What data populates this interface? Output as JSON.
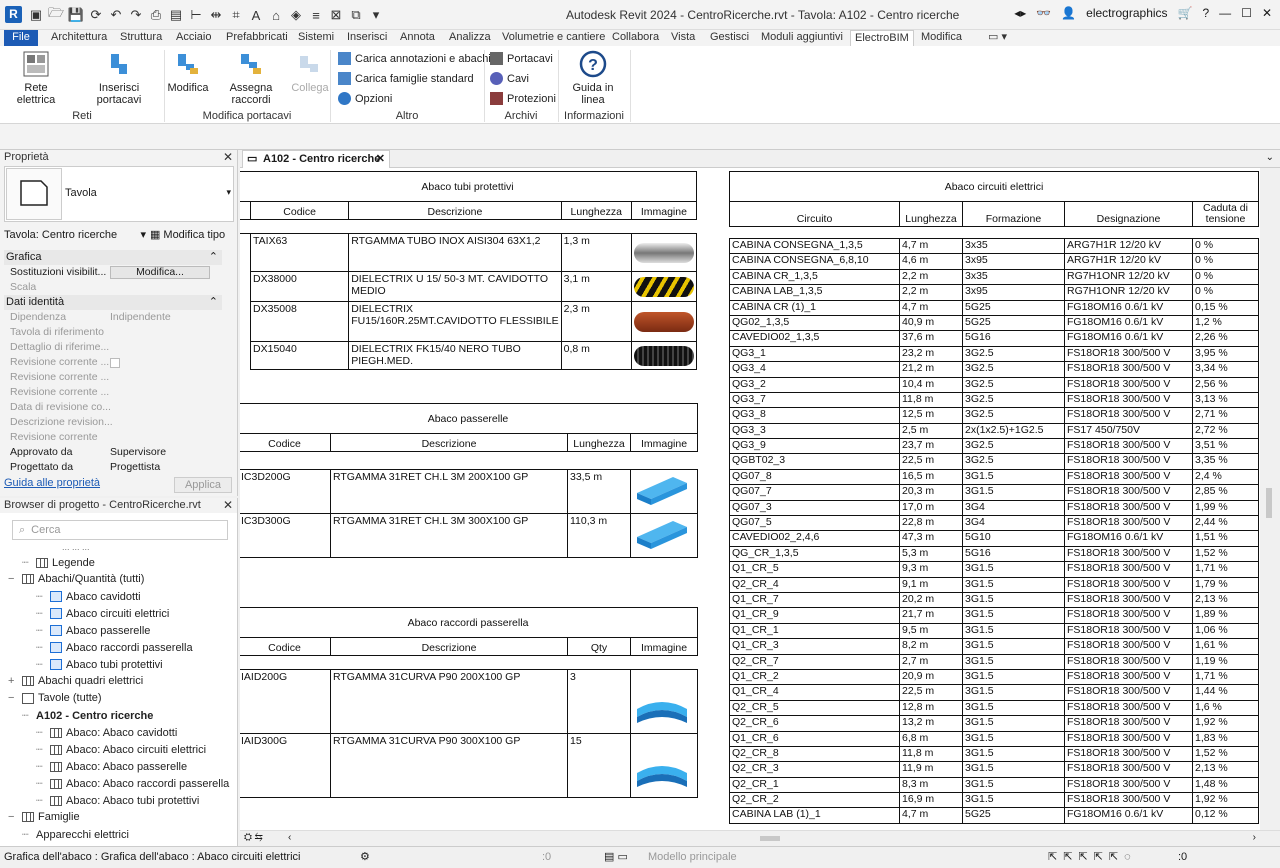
{
  "window": {
    "title": "Autodesk Revit 2024 - CentroRicerche.rvt - Tavola: A102 - Centro ricerche",
    "user": "electrographics"
  },
  "menu_tabs": [
    "File",
    "Architettura",
    "Struttura",
    "Acciaio",
    "Prefabbricati",
    "Sistemi",
    "Inserisci",
    "Annota",
    "Analizza",
    "Volumetrie e cantiere",
    "Collabora",
    "Vista",
    "Gestisci",
    "Moduli aggiuntivi",
    "ElectroBIM",
    "Modifica"
  ],
  "ribbon": {
    "rete_elettrica": "Rete elettrica",
    "inserisci_portacavi": "Inserisci portacavi",
    "modifica": "Modifica",
    "assegna_raccordi": "Assegna raccordi",
    "collega": "Collega",
    "carica_annotazioni": "Carica annotazioni e abachi",
    "carica_famiglie": "Carica famiglie standard",
    "opzioni": "Opzioni",
    "portacavi": "Portacavi",
    "cavi": "Cavi",
    "protezioni": "Protezioni",
    "guida_in_linea": "Guida in linea",
    "groups": {
      "reti": "Reti",
      "modifica_portacavi": "Modifica portacavi",
      "altro": "Altro",
      "archivi": "Archivi",
      "informazioni": "Informazioni"
    }
  },
  "properties": {
    "title": "Proprietà",
    "type_name": "Tavola",
    "selector": "Tavola: Centro ricerche",
    "modifica_tipo": "Modifica tipo",
    "sec_grafica": "Grafica",
    "sostituzioni": "Sostituzioni visibilit...",
    "modifica_btn": "Modifica...",
    "scala": "Scala",
    "sec_dati": "Dati identità",
    "rows": [
      {
        "label": "Dipendenza",
        "value": "Indipendente"
      },
      {
        "label": "Tavola di riferimento",
        "value": ""
      },
      {
        "label": "Dettaglio di riferime...",
        "value": ""
      },
      {
        "label": "Revisione corrente ...",
        "value": ""
      },
      {
        "label": "Revisione corrente ...",
        "value": ""
      },
      {
        "label": "Revisione corrente ...",
        "value": ""
      },
      {
        "label": "Data di revisione co...",
        "value": ""
      },
      {
        "label": "Descrizione revision...",
        "value": ""
      },
      {
        "label": "Revisione corrente",
        "value": ""
      },
      {
        "label": "Approvato da",
        "value": "Supervisore"
      },
      {
        "label": "Progettato da",
        "value": "Progettista"
      }
    ],
    "help_link": "Guida alle proprietà",
    "apply": "Applica"
  },
  "browser": {
    "title": "Browser di progetto - CentroRicerche.rvt",
    "search_placeholder": "Cerca",
    "cut_item": "... ... ...",
    "items": [
      {
        "label": "Legende",
        "indent": 1,
        "icon": "grid"
      },
      {
        "label": "Abachi/Quantità (tutti)",
        "indent": 0,
        "icon": "grid"
      },
      {
        "label": "Abaco cavidotti",
        "indent": 2,
        "icon": "sel"
      },
      {
        "label": "Abaco circuiti elettrici",
        "indent": 2,
        "icon": "sel"
      },
      {
        "label": "Abaco passerelle",
        "indent": 2,
        "icon": "sel"
      },
      {
        "label": "Abaco raccordi passerella",
        "indent": 2,
        "icon": "sel"
      },
      {
        "label": "Abaco tubi protettivi",
        "indent": 2,
        "icon": "sel"
      },
      {
        "label": "Abachi quadri elettrici",
        "indent": 0,
        "icon": "grid"
      },
      {
        "label": "Tavole (tutte)",
        "indent": 0,
        "icon": "sheet"
      },
      {
        "label": "A102 - Centro ricerche",
        "indent": 1,
        "icon": "none",
        "bold": true
      },
      {
        "label": "Abaco: Abaco cavidotti",
        "indent": 2,
        "icon": "grid"
      },
      {
        "label": "Abaco: Abaco circuiti elettrici",
        "indent": 2,
        "icon": "grid"
      },
      {
        "label": "Abaco: Abaco passerelle",
        "indent": 2,
        "icon": "grid"
      },
      {
        "label": "Abaco: Abaco raccordi passerella",
        "indent": 2,
        "icon": "grid"
      },
      {
        "label": "Abaco: Abaco tubi protettivi",
        "indent": 2,
        "icon": "grid"
      },
      {
        "label": "Famiglie",
        "indent": 0,
        "icon": "grid"
      },
      {
        "label": "Apparecchi elettrici",
        "indent": 1,
        "icon": "none"
      }
    ]
  },
  "doc_tab": "A102 - Centro ricerche",
  "tubi": {
    "title": "Abaco tubi protettivi",
    "headers": [
      "Codice",
      "Descrizione",
      "Lunghezza",
      "Immagine"
    ],
    "rows": [
      {
        "codice": "TAIX63",
        "descr": "RTGAMMA TUBO INOX AISI304 63X1,2",
        "lung": "1,3 m",
        "img": "steel"
      },
      {
        "codice": "DX38000",
        "descr": "DIELECTRIX U 15/ 50-3 MT. CAVIDOTTO MEDIO",
        "lung": "3,1 m",
        "img": "yellow"
      },
      {
        "codice": "DX35008",
        "descr": "DIELECTRIX FU15/160R.25MT.CAVIDOTTO FLESSIBILE",
        "lung": "2,3 m",
        "img": "red"
      },
      {
        "codice": "DX15040",
        "descr": "DIELECTRIX FK15/40  NERO   TUBO PIEGH.MED.",
        "lung": "0,8 m",
        "img": "black"
      }
    ]
  },
  "passerelle": {
    "title": "Abaco passerelle",
    "headers": [
      "Codice",
      "Descrizione",
      "Lunghezza",
      "Immagine"
    ],
    "rows": [
      {
        "codice": "IC3D200G",
        "descr": "RTGAMMA 31RET CH.L 3M 200X100 GP",
        "lung": "33,5 m"
      },
      {
        "codice": "IC3D300G",
        "descr": "RTGAMMA 31RET CH.L 3M 300X100 GP",
        "lung": "110,3 m"
      }
    ]
  },
  "raccordi": {
    "title": "Abaco raccordi passerella",
    "headers": [
      "Codice",
      "Descrizione",
      "Qty",
      "Immagine"
    ],
    "rows": [
      {
        "codice": "IAID200G",
        "descr": "RTGAMMA 31CURVA P90 200X100 GP",
        "qty": "3"
      },
      {
        "codice": "IAID300G",
        "descr": "RTGAMMA 31CURVA P90 300X100 GP",
        "qty": "15"
      }
    ]
  },
  "circuiti": {
    "title": "Abaco circuiti elettrici",
    "headers": [
      "Circuito",
      "Lunghezza",
      "Formazione",
      "Designazione",
      "Caduta di tensione"
    ],
    "rows": [
      [
        "CABINA CONSEGNA_1,3,5",
        "4,7 m",
        "3x35",
        "ARG7H1R 12/20 kV",
        "0 %"
      ],
      [
        "CABINA CONSEGNA_6,8,10",
        "4,6 m",
        "3x95",
        "ARG7H1R 12/20 kV",
        "0 %"
      ],
      [
        "CABINA CR_1,3,5",
        "2,2 m",
        "3x35",
        "RG7H1ONR 12/20 kV",
        "0 %"
      ],
      [
        "CABINA LAB_1,3,5",
        "2,2 m",
        "3x95",
        "RG7H1ONR 12/20 kV",
        "0 %"
      ],
      [
        "CABINA CR (1)_1",
        "4,7 m",
        "5G25",
        "FG18OM16 0.6/1 kV",
        "0,15 %"
      ],
      [
        "QG02_1,3,5",
        "40,9 m",
        "5G25",
        "FG18OM16 0.6/1 kV",
        "1,2 %"
      ],
      [
        "CAVEDIO02_1,3,5",
        "37,6 m",
        "5G16",
        "FG18OM16 0.6/1 kV",
        "2,26 %"
      ],
      [
        "QG3_1",
        "23,2 m",
        "3G2.5",
        "FS18OR18 300/500 V",
        "3,95 %"
      ],
      [
        "QG3_4",
        "21,2 m",
        "3G2.5",
        "FS18OR18 300/500 V",
        "3,34 %"
      ],
      [
        "QG3_2",
        "10,4 m",
        "3G2.5",
        "FS18OR18 300/500 V",
        "2,56 %"
      ],
      [
        "QG3_7",
        "11,8 m",
        "3G2.5",
        "FS18OR18 300/500 V",
        "3,13 %"
      ],
      [
        "QG3_8",
        "12,5 m",
        "3G2.5",
        "FS18OR18 300/500 V",
        "2,71 %"
      ],
      [
        "QG3_3",
        "2,5 m",
        "2x(1x2.5)+1G2.5",
        "FS17 450/750V",
        "2,72 %"
      ],
      [
        "QG3_9",
        "23,7 m",
        "3G2.5",
        "FS18OR18 300/500 V",
        "3,51 %"
      ],
      [
        "QGBT02_3",
        "22,5 m",
        "3G2.5",
        "FS18OR18 300/500 V",
        "3,35 %"
      ],
      [
        "QG07_8",
        "16,5 m",
        "3G1.5",
        "FS18OR18 300/500 V",
        "2,4 %"
      ],
      [
        "QG07_7",
        "20,3 m",
        "3G1.5",
        "FS18OR18 300/500 V",
        "2,85 %"
      ],
      [
        "QG07_3",
        "17,0 m",
        "3G4",
        "FS18OR18 300/500 V",
        "1,99 %"
      ],
      [
        "QG07_5",
        "22,8 m",
        "3G4",
        "FS18OR18 300/500 V",
        "2,44 %"
      ],
      [
        "CAVEDIO02_2,4,6",
        "47,3 m",
        "5G10",
        "FG18OM16 0.6/1 kV",
        "1,51 %"
      ],
      [
        "QG_CR_1,3,5",
        "5,3 m",
        "5G16",
        "FS18OR18 300/500 V",
        "1,52 %"
      ],
      [
        "Q1_CR_5",
        "9,3 m",
        "3G1.5",
        "FS18OR18 300/500 V",
        "1,71 %"
      ],
      [
        "Q2_CR_4",
        "9,1 m",
        "3G1.5",
        "FS18OR18 300/500 V",
        "1,79 %"
      ],
      [
        "Q1_CR_7",
        "20,2 m",
        "3G1.5",
        "FS18OR18 300/500 V",
        "2,13 %"
      ],
      [
        "Q1_CR_9",
        "21,7 m",
        "3G1.5",
        "FS18OR18 300/500 V",
        "1,89 %"
      ],
      [
        "Q1_CR_1",
        "9,5 m",
        "3G1.5",
        "FS18OR18 300/500 V",
        "1,06 %"
      ],
      [
        "Q1_CR_3",
        "8,2 m",
        "3G1.5",
        "FS18OR18 300/500 V",
        "1,61 %"
      ],
      [
        "Q2_CR_7",
        "2,7 m",
        "3G1.5",
        "FS18OR18 300/500 V",
        "1,19 %"
      ],
      [
        "Q1_CR_2",
        "20,9 m",
        "3G1.5",
        "FS18OR18 300/500 V",
        "1,71 %"
      ],
      [
        "Q1_CR_4",
        "22,5 m",
        "3G1.5",
        "FS18OR18 300/500 V",
        "1,44 %"
      ],
      [
        "Q2_CR_5",
        "12,8 m",
        "3G1.5",
        "FS18OR18 300/500 V",
        "1,6 %"
      ],
      [
        "Q2_CR_6",
        "13,2 m",
        "3G1.5",
        "FS18OR18 300/500 V",
        "1,92 %"
      ],
      [
        "Q1_CR_6",
        "6,8 m",
        "3G1.5",
        "FS18OR18 300/500 V",
        "1,83 %"
      ],
      [
        "Q2_CR_8",
        "11,8 m",
        "3G1.5",
        "FS18OR18 300/500 V",
        "1,52 %"
      ],
      [
        "Q2_CR_3",
        "11,9 m",
        "3G1.5",
        "FS18OR18 300/500 V",
        "2,13 %"
      ],
      [
        "Q2_CR_1",
        "8,3 m",
        "3G1.5",
        "FS18OR18 300/500 V",
        "1,48 %"
      ],
      [
        "Q2_CR_2",
        "16,9 m",
        "3G1.5",
        "FS18OR18 300/500 V",
        "1,92 %"
      ],
      [
        "CABINA LAB (1)_1",
        "4,7 m",
        "5G25",
        "FG18OM16 0.6/1 kV",
        "0,12 %"
      ]
    ]
  },
  "status": {
    "text": "Grafica dell'abaco : Grafica dell'abaco : Abaco circuiti elettrici",
    "count": ":0",
    "model": "Modello principale",
    "filter": ":0"
  }
}
